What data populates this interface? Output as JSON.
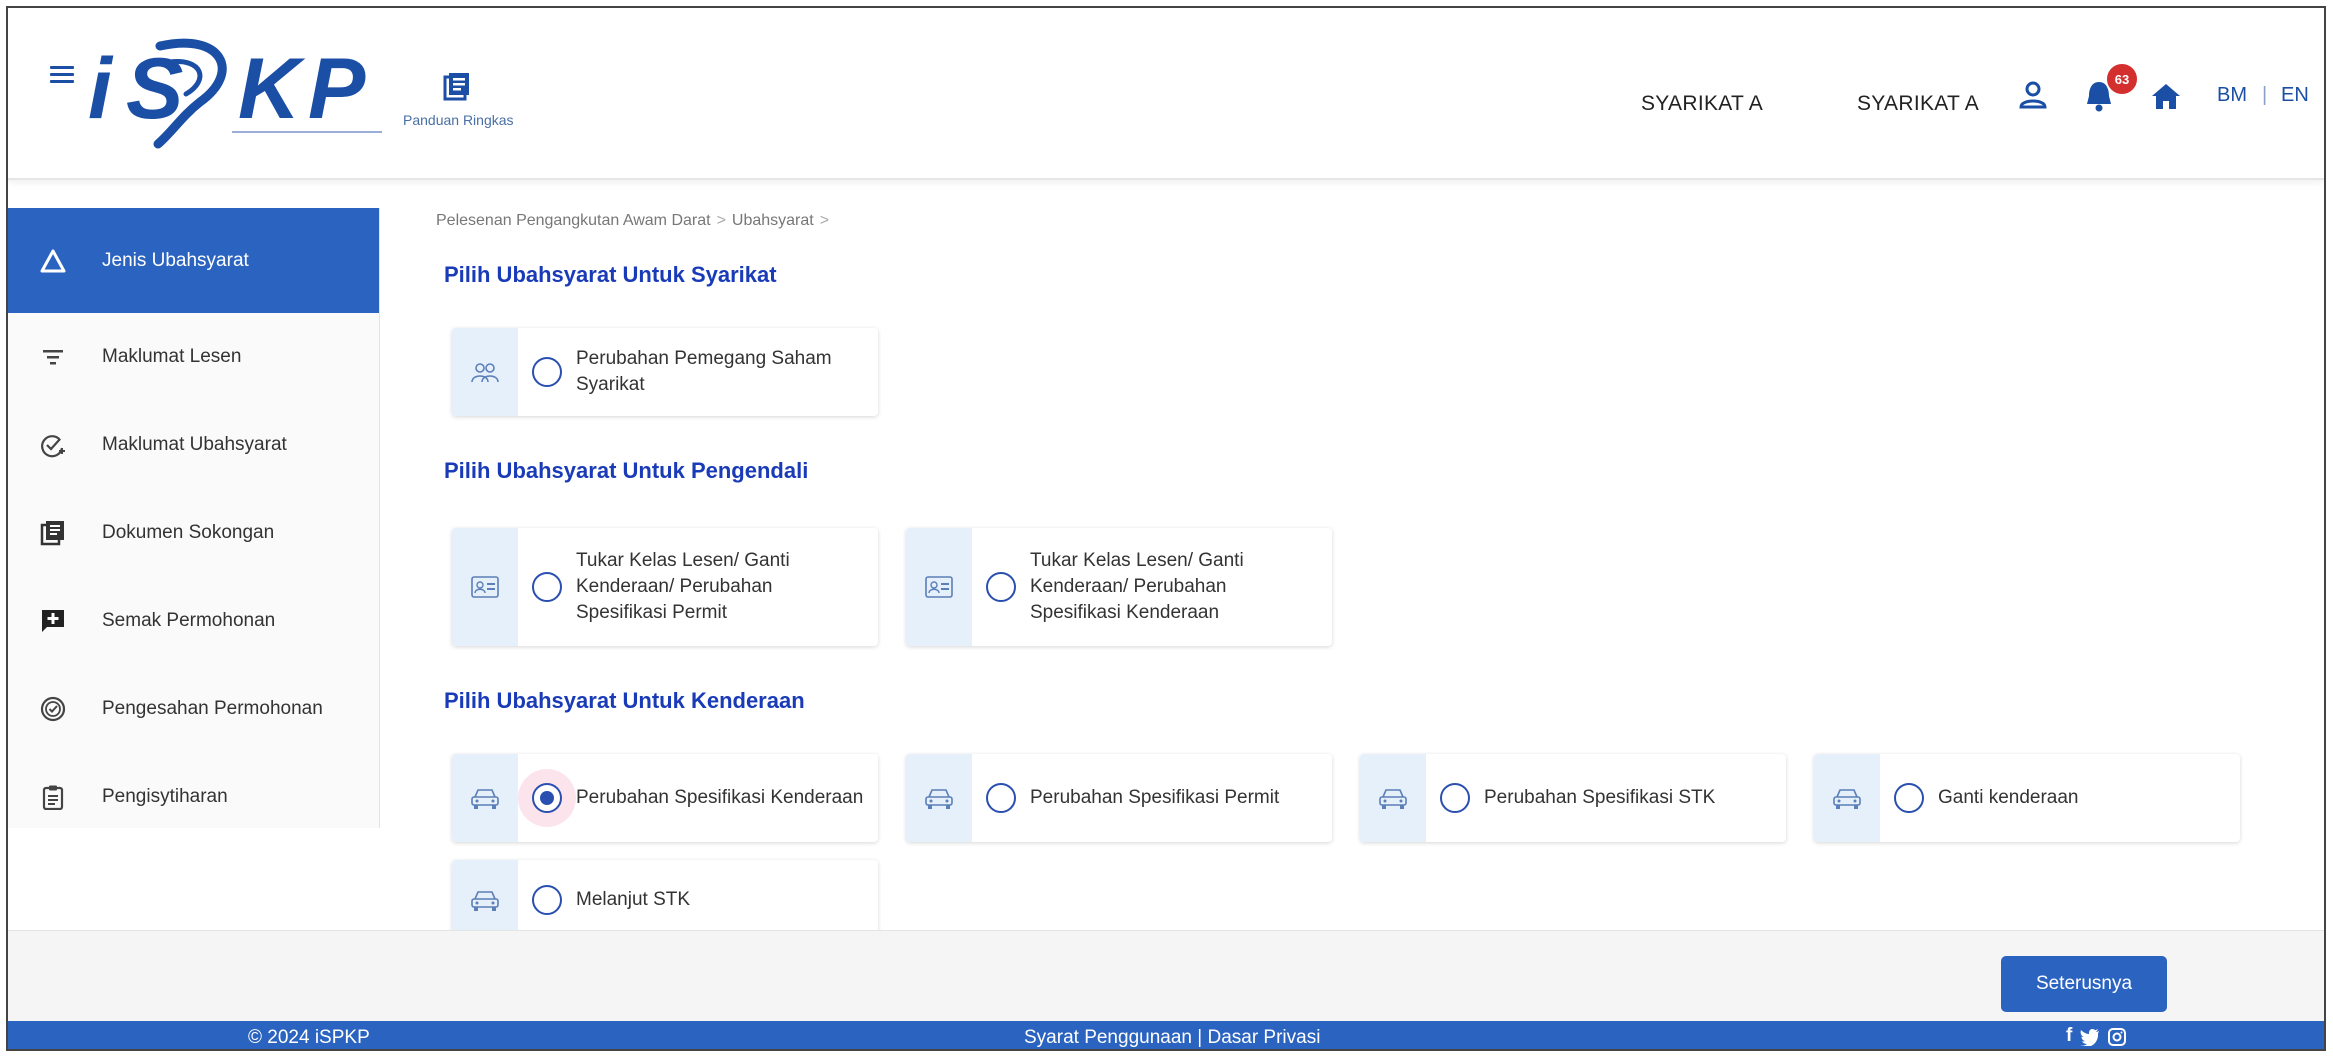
{
  "header": {
    "logo_text": "iSPKP",
    "quick_guide_label": "Panduan Ringkas",
    "company_name_1": "SYARIKAT A",
    "company_name_2": "SYARIKAT A",
    "notification_count": "63",
    "lang_bm": "BM",
    "lang_sep": "|",
    "lang_en": "EN",
    "icons": [
      "menu-icon",
      "book-icon",
      "user-icon",
      "bell-icon",
      "home-icon"
    ]
  },
  "sidebar": {
    "items": [
      {
        "label": "Jenis Ubahsyarat",
        "icon": "triangle-icon",
        "active": true
      },
      {
        "label": "Maklumat Lesen",
        "icon": "filter-icon"
      },
      {
        "label": "Maklumat Ubahsyarat",
        "icon": "check-circle-icon"
      },
      {
        "label": "Dokumen Sokongan",
        "icon": "book-icon"
      },
      {
        "label": "Semak Permohonan",
        "icon": "add-comment-icon"
      },
      {
        "label": "Pengesahan Permohonan",
        "icon": "verified-icon"
      },
      {
        "label": "Pengisytiharan",
        "icon": "clipboard-icon"
      }
    ]
  },
  "breadcrumb": {
    "item1": "Pelesenan Pengangkutan Awam Darat",
    "sep": ">",
    "item2": "Ubahsyarat"
  },
  "sections": {
    "company": {
      "title": "Pilih Ubahsyarat Untuk Syarikat",
      "options": [
        {
          "label": "Perubahan Pemegang Saham Syarikat",
          "icon": "people-icon",
          "selected": false
        }
      ]
    },
    "controller": {
      "title": "Pilih Ubahsyarat Untuk Pengendali",
      "options": [
        {
          "label": "Tukar Kelas Lesen/ Ganti Kenderaan/ Perubahan Spesifikasi Permit",
          "icon": "id-card-icon",
          "selected": false
        },
        {
          "label": "Tukar Kelas Lesen/ Ganti Kenderaan/ Perubahan Spesifikasi Kenderaan",
          "icon": "id-card-icon",
          "selected": false
        }
      ]
    },
    "vehicle": {
      "title": "Pilih Ubahsyarat Untuk Kenderaan",
      "options": [
        {
          "label": "Perubahan Spesifikasi Kenderaan",
          "icon": "car-icon",
          "selected": true
        },
        {
          "label": "Perubahan Spesifikasi Permit",
          "icon": "car-icon",
          "selected": false
        },
        {
          "label": "Perubahan Spesifikasi STK",
          "icon": "car-icon",
          "selected": false
        },
        {
          "label": "Ganti kenderaan",
          "icon": "car-icon",
          "selected": false
        },
        {
          "label": "Melanjut STK",
          "icon": "car-icon",
          "selected": false
        }
      ]
    }
  },
  "actions": {
    "next_label": "Seterusnya"
  },
  "footer": {
    "copyright": "© 2024 iSPKP",
    "terms": "Syarat Penggunaan",
    "links_sep": "|",
    "privacy": "Dasar Privasi",
    "social_icons": [
      "facebook-icon",
      "twitter-icon",
      "instagram-icon"
    ]
  },
  "colors": {
    "primary": "#2b63c0",
    "section_title": "#1a3bb8",
    "icon_box": "#e6f0fb",
    "badge": "#d32f2f"
  }
}
